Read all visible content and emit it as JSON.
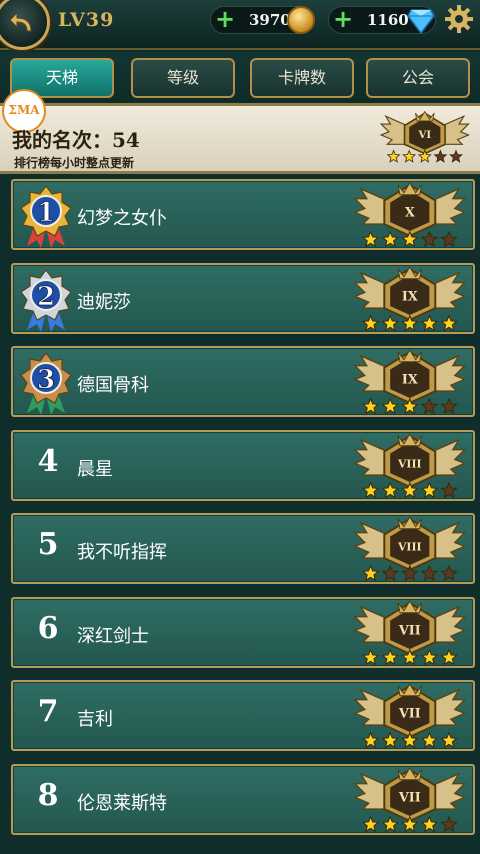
{
  "header": {
    "level": "LV39",
    "gold": "3970",
    "gems": "1160"
  },
  "tabs": [
    {
      "label": "天梯",
      "active": true
    },
    {
      "label": "等级",
      "active": false
    },
    {
      "label": "卡牌数",
      "active": false
    },
    {
      "label": "公会",
      "active": false
    }
  ],
  "my_rank": {
    "logo_text": "ΣMA",
    "title": "我的名次：54",
    "note": "排行榜每小时整点更新",
    "tier": "VI",
    "stars": 3
  },
  "ranking": [
    {
      "rank": "1",
      "name": "幻梦之女仆",
      "tier": "X",
      "stars": 3
    },
    {
      "rank": "2",
      "name": "迪妮莎",
      "tier": "IX",
      "stars": 5
    },
    {
      "rank": "3",
      "name": "德国骨科",
      "tier": "IX",
      "stars": 3
    },
    {
      "rank": "4",
      "name": "晨星",
      "tier": "VIII",
      "stars": 4
    },
    {
      "rank": "5",
      "name": "我不听指挥",
      "tier": "VIII",
      "stars": 1
    },
    {
      "rank": "6",
      "name": "深红剑士",
      "tier": "VII",
      "stars": 5
    },
    {
      "rank": "7",
      "name": "吉利",
      "tier": "VII",
      "stars": 5
    },
    {
      "rank": "8",
      "name": "伦恩莱斯特",
      "tier": "VII",
      "stars": 4
    }
  ],
  "colors": {
    "gold_accent": "#c9a75a",
    "row_bg": "#2f6d64",
    "active_tab": "#1f9a8c"
  }
}
